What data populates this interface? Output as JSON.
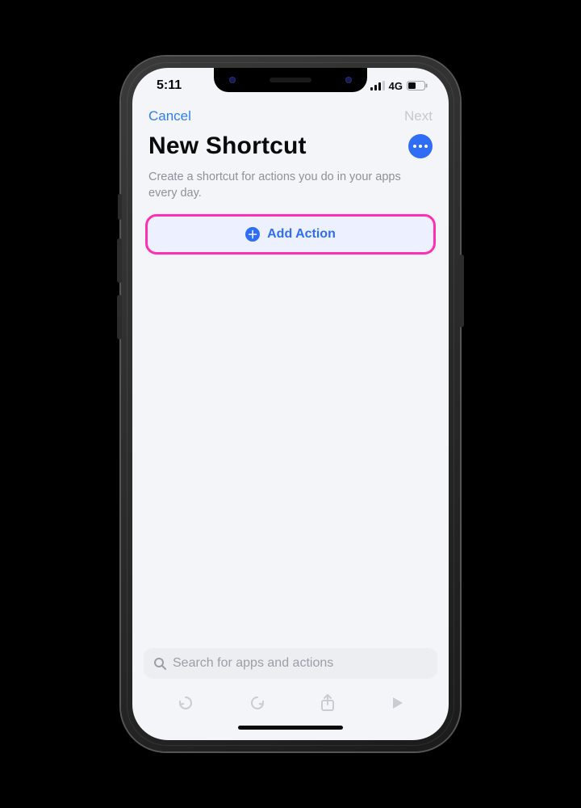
{
  "statusbar": {
    "time": "5:11",
    "network_label": "4G"
  },
  "nav": {
    "cancel": "Cancel",
    "next": "Next"
  },
  "header": {
    "title": "New Shortcut",
    "subtitle": "Create a shortcut for actions you do in your apps every day."
  },
  "actions": {
    "add_action_label": "Add Action"
  },
  "search": {
    "placeholder": "Search for apps and actions"
  }
}
